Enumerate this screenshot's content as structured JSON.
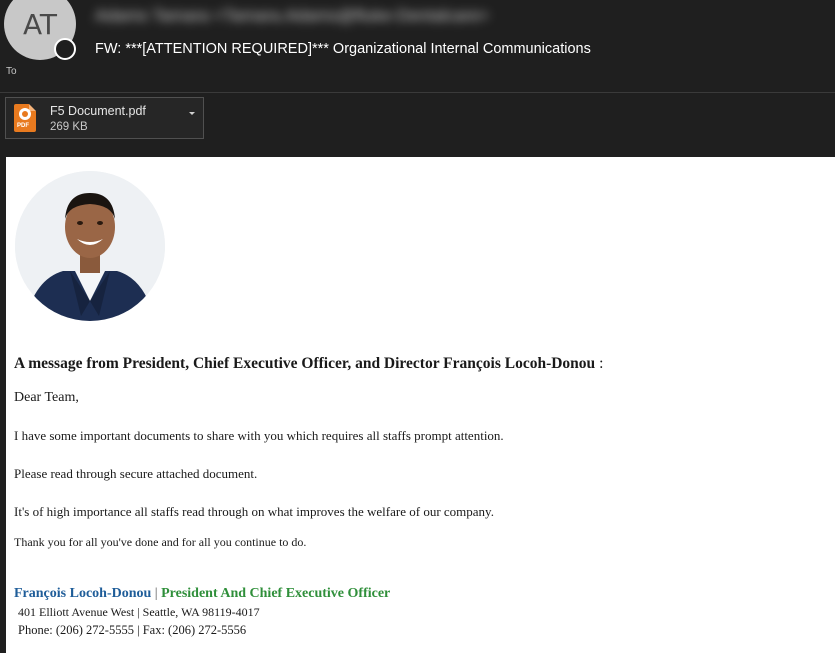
{
  "header": {
    "avatar_initials": "AT",
    "sender": "Adams Tamara <Tamara.Adams@fluke-Dentalcare>",
    "subject": "FW: ***[ATTENTION REQUIRED]*** Organizational Internal Communications",
    "to_label": "To"
  },
  "attachment": {
    "name": "F5 Document.pdf",
    "size": "269 KB",
    "icon": "pdf-file-icon"
  },
  "body": {
    "heading": "A message from President, Chief Executive Officer, and Director François Locoh-Donou",
    "heading_colon": ":",
    "greeting": "Dear Team,",
    "paragraphs": [
      "I have some important documents to share with you which requires all staffs prompt attention.",
      "Please read through secure attached document.",
      "It's of high importance all staffs read through on what improves the welfare of our company.",
      "Thank you for all you've done and for all you continue to do."
    ],
    "signature": {
      "name": "François Locoh-Donou",
      "separator": "|",
      "title": "President And Chief Executive Officer",
      "address": "401 Elliott Avenue West | Seattle, WA 98119-4017",
      "phone": "Phone: (206) 272-5555 | Fax: (206) 272-5556"
    }
  },
  "colors": {
    "header_bg": "#1f1f1f",
    "signature_name": "#1f5d99",
    "signature_title": "#2f8f3a",
    "pdf_orange": "#e87a1f"
  }
}
